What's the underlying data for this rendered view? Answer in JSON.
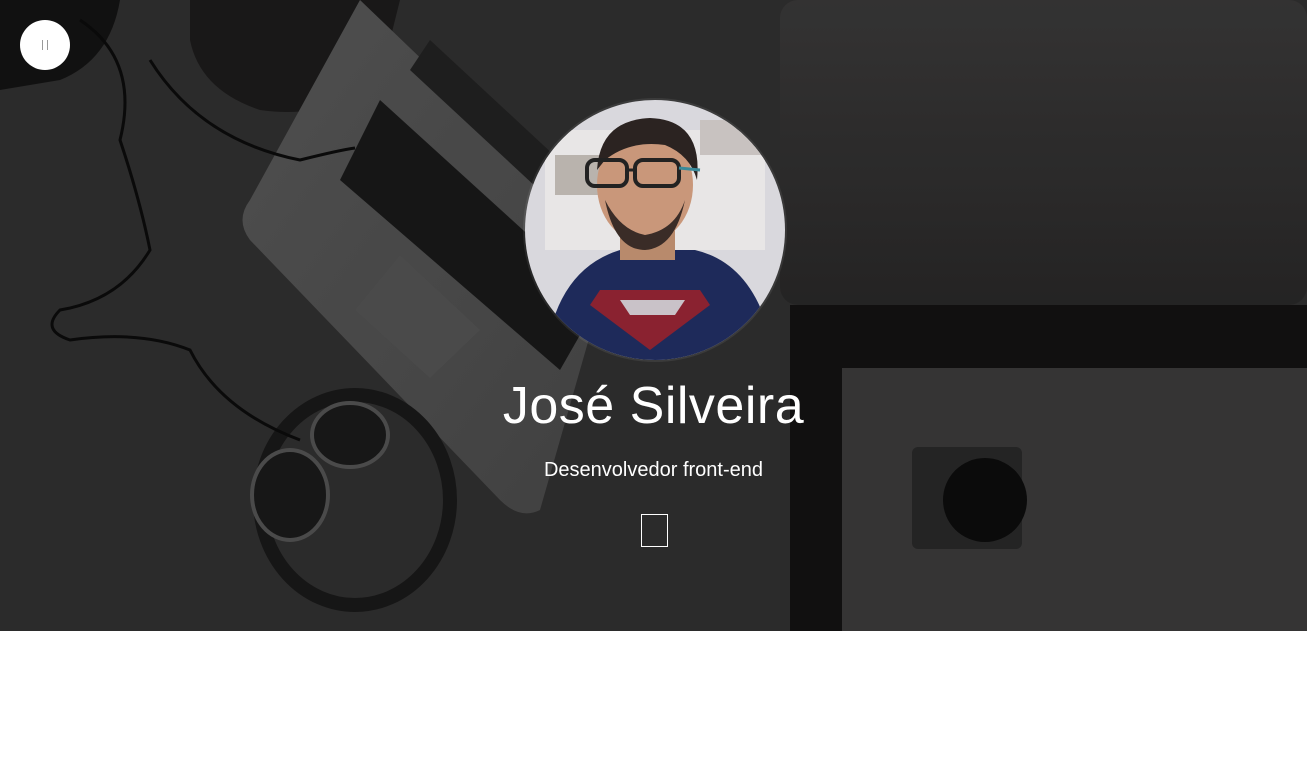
{
  "profile": {
    "name": "José Silveira",
    "role": "Desenvolvedor front-end"
  },
  "icons": {
    "menu": "menu-icon",
    "scroll": "scroll-down-icon"
  },
  "colors": {
    "hero_overlay": "#2b2a2a",
    "text": "#ffffff",
    "page_background": "#ffffff"
  }
}
